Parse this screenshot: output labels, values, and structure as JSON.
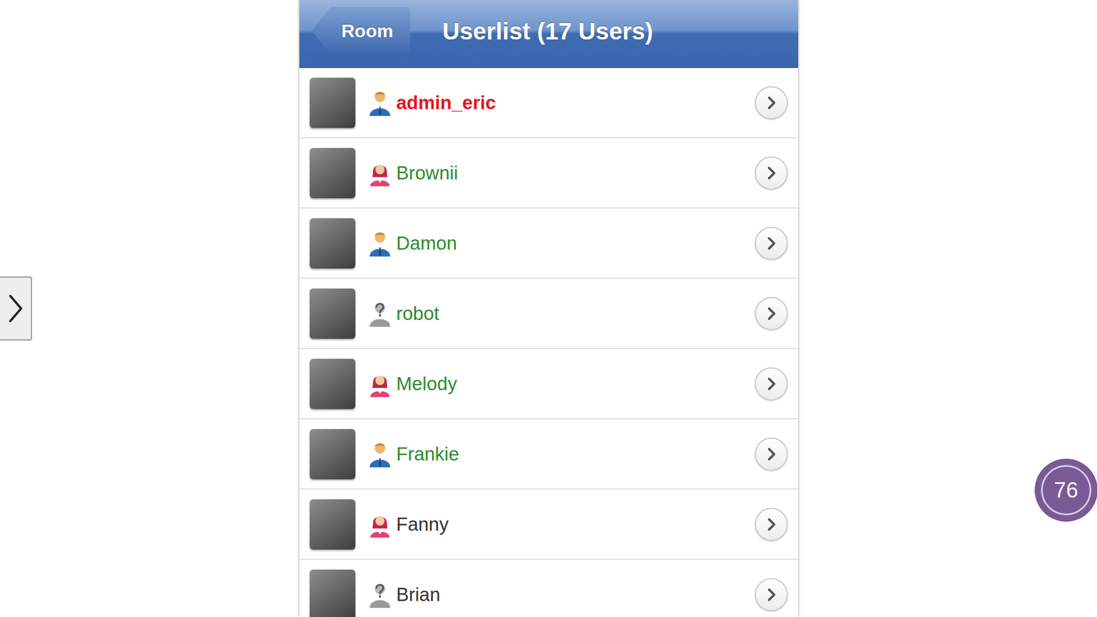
{
  "header": {
    "back_button": "Room",
    "title": "Userlist (17 Users)"
  },
  "users": [
    {
      "name": "admin_eric",
      "kind": "male",
      "color": "#e8141b"
    },
    {
      "name": "Brownii",
      "kind": "female",
      "color": "#2e8b2e"
    },
    {
      "name": "Damon",
      "kind": "male",
      "color": "#2e8b2e"
    },
    {
      "name": "robot",
      "kind": "unknown",
      "color": "#2e8b2e"
    },
    {
      "name": "Melody",
      "kind": "female",
      "color": "#2e8b2e"
    },
    {
      "name": "Frankie",
      "kind": "male",
      "color": "#2e8b2e"
    },
    {
      "name": "Fanny",
      "kind": "female",
      "color": "#333333"
    },
    {
      "name": "Brian",
      "kind": "unknown",
      "color": "#333333"
    }
  ],
  "badge": {
    "count": "76"
  }
}
